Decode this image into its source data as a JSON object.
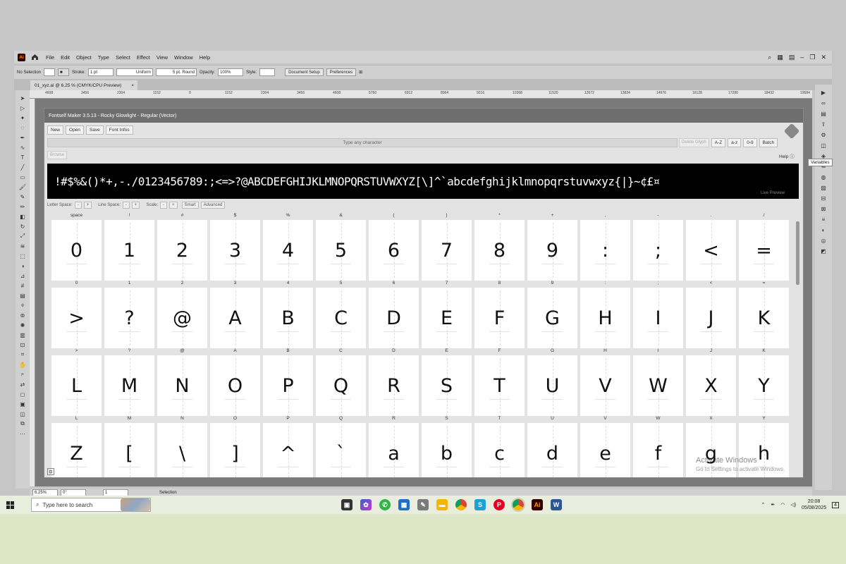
{
  "menubar": {
    "items": [
      "File",
      "Edit",
      "Object",
      "Type",
      "Select",
      "Effect",
      "View",
      "Window",
      "Help"
    ]
  },
  "control": {
    "selection": "No Selection",
    "stroke_label": "Stroke:",
    "stroke_value": "1 pt",
    "profile": "Uniform",
    "brush": "5 pt. Round",
    "opacity_label": "Opacity:",
    "opacity_value": "100%",
    "style_label": "Style:",
    "document_setup": "Document Setup",
    "preferences": "Preferences"
  },
  "document": {
    "tab": "01_xyz.ai @ 6.25 % (CMYK/CPU Preview)"
  },
  "ruler": {
    "ticks": [
      "4608",
      "3456",
      "2304",
      "1152",
      "0",
      "1152",
      "2304",
      "3456",
      "4608",
      "5760",
      "6912",
      "8064",
      "9216",
      "10368",
      "11520",
      "12672",
      "13824",
      "14976",
      "16128",
      "17280",
      "18432",
      "19584"
    ]
  },
  "plugin": {
    "title": "Fontself Maker 3.5.13 - Rocky Glowlight - Regular (Vector)",
    "buttons": [
      "New",
      "Open",
      "Save",
      "Font Infos"
    ],
    "input_placeholder": "Type any character",
    "right_buttons": [
      "Delete Glyph",
      "A-Z",
      "a-z",
      "0-9",
      "Batch"
    ],
    "browse": "Browse",
    "help": "Help",
    "preview_text": "!#$%&()*+,-./0123456789:;<=>?@ABCDEFGHIJKLMNOPQRSTUVWXYZ[\\]^`abcdefghijklmnopqrstuvwxyz{|}~¢£¤",
    "live_preview": "Live Preview",
    "letter_space": "Letter Space:",
    "line_space": "Line Space:",
    "scale": "Scale:",
    "minus": "-",
    "plus": "+",
    "smart": "Smart",
    "advanced": "Advanced"
  },
  "glyph_rows": [
    {
      "header": [
        "space",
        "!",
        "#",
        "$",
        "%",
        "&",
        "(",
        ")",
        "*",
        "+",
        ",",
        "-",
        ".",
        "/"
      ],
      "glyphs": [
        "0",
        "1",
        "2",
        "3",
        "4",
        "5",
        "6",
        "7",
        "8",
        "9",
        ":",
        ";",
        "<",
        "="
      ]
    },
    {
      "header": [
        "0",
        "1",
        "2",
        "3",
        "4",
        "5",
        "6",
        "7",
        "8",
        "9",
        ":",
        ";",
        "<",
        "="
      ],
      "glyphs": [
        ">",
        "?",
        "@",
        "A",
        "B",
        "C",
        "D",
        "E",
        "F",
        "G",
        "H",
        "I",
        "J",
        "K"
      ]
    },
    {
      "header": [
        ">",
        "?",
        "@",
        "A",
        "B",
        "C",
        "D",
        "E",
        "F",
        "G",
        "H",
        "I",
        "J",
        "K"
      ],
      "glyphs": [
        "L",
        "M",
        "N",
        "O",
        "P",
        "Q",
        "R",
        "S",
        "T",
        "U",
        "V",
        "W",
        "X",
        "Y"
      ]
    },
    {
      "header": [
        "L",
        "M",
        "N",
        "O",
        "P",
        "Q",
        "R",
        "S",
        "T",
        "U",
        "V",
        "W",
        "X",
        "Y"
      ],
      "glyphs": [
        "Z",
        "[",
        "\\",
        "]",
        "^",
        "`",
        "a",
        "b",
        "c",
        "d",
        "e",
        "f",
        "g",
        "h"
      ]
    }
  ],
  "tooltip": "Variables",
  "watermark": {
    "title": "Activate Windows",
    "sub": "Go to Settings to activate Windows."
  },
  "status": {
    "zoom": "6.25%",
    "angle": "0°",
    "artboard": "1",
    "mode": "Selection"
  },
  "taskbar": {
    "search_placeholder": "Type here to search",
    "time": "20:08",
    "date": "05/08/2025",
    "notifications": "4"
  }
}
